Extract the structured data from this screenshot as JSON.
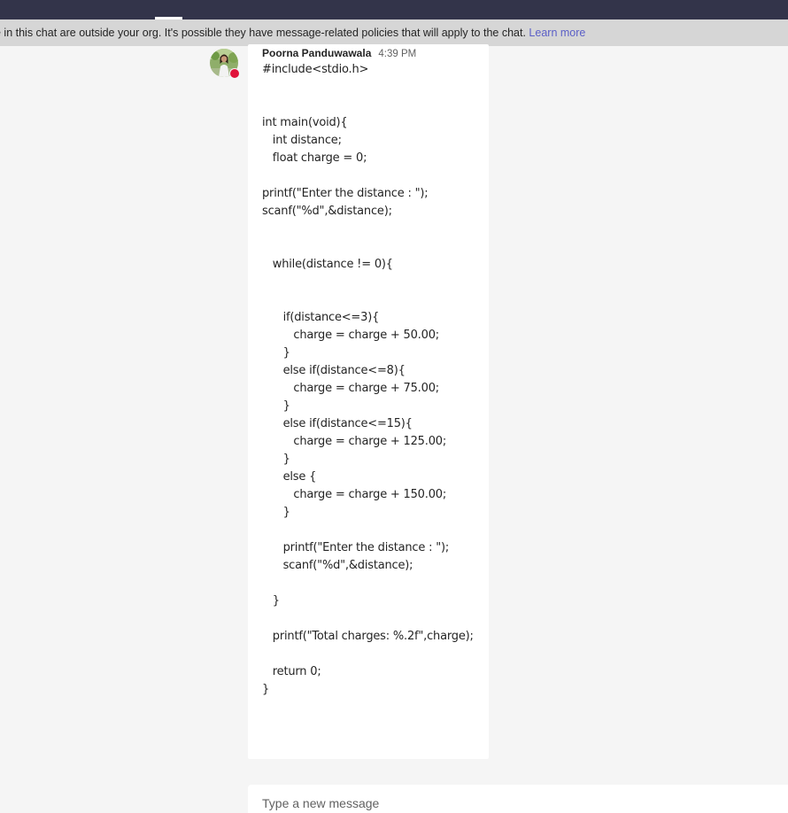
{
  "banner": {
    "text": "e in this chat are outside your org. It's possible they have message-related policies that will apply to the chat.",
    "link_label": "Learn more"
  },
  "message": {
    "author": "Poorna Panduwawala",
    "time": "4:39 PM",
    "status_color": "#e0133a",
    "body": "#include<stdio.h>\n\n\nint main(void){\n   int distance;\n   float charge = 0;\n\nprintf(\"Enter the distance : \");\nscanf(\"%d\",&distance);\n\n\n   while(distance != 0){\n\n\n      if(distance<=3){\n         charge = charge + 50.00;\n      }\n      else if(distance<=8){\n         charge = charge + 75.00;\n      }\n      else if(distance<=15){\n         charge = charge + 125.00;\n      }\n      else {\n         charge = charge + 150.00;\n      }\n\n      printf(\"Enter the distance : \");\n      scanf(\"%d\",&distance);\n\n   }\n\n   printf(\"Total charges: %.2f\",charge);\n\n   return 0;\n}"
  },
  "compose": {
    "placeholder": "Type a new message"
  },
  "colors": {
    "topbar": "#33344a",
    "link": "#5b5fc7",
    "page_background": "#f5f5f5"
  }
}
